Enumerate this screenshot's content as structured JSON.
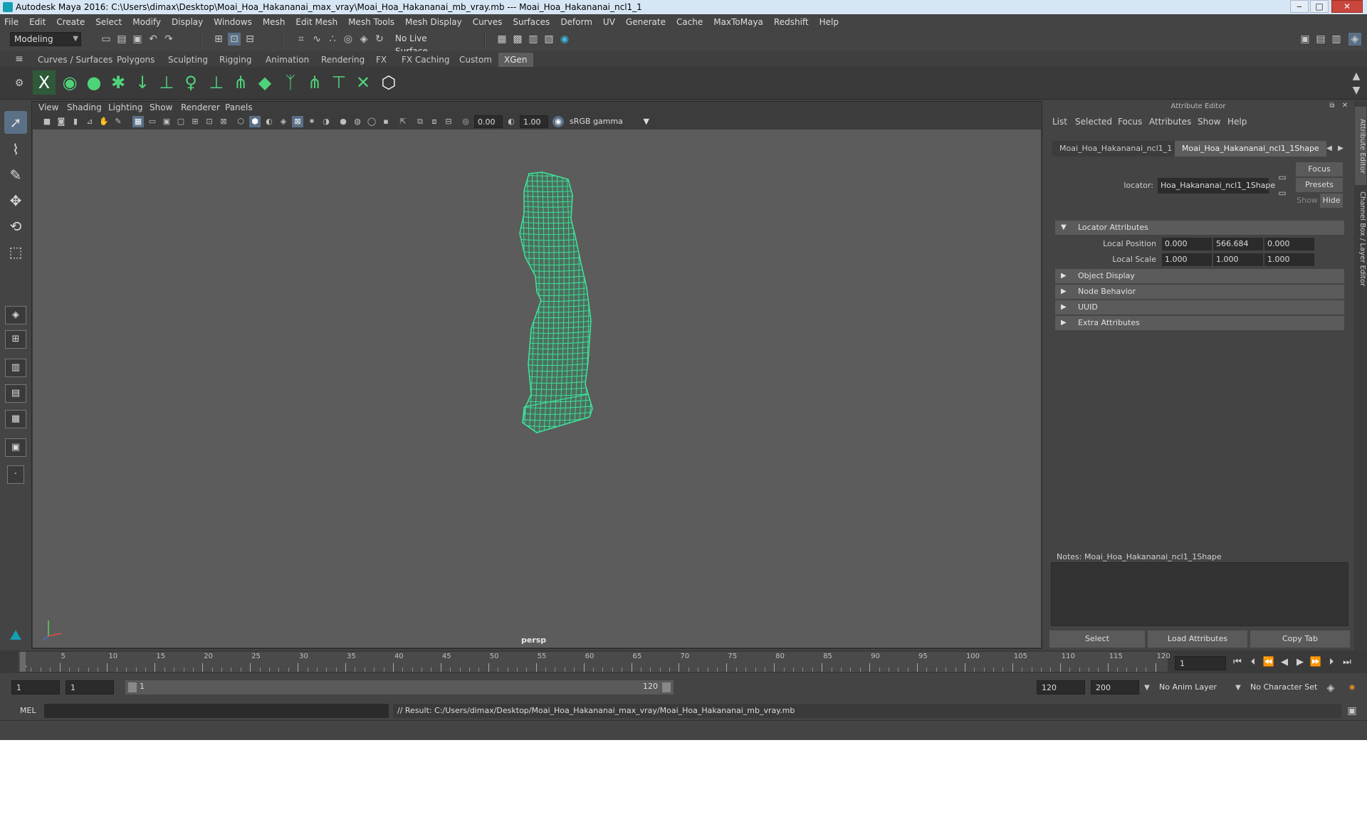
{
  "window": {
    "title": "Autodesk Maya 2016: C:\\Users\\dimax\\Desktop\\Moai_Hoa_Hakananai_max_vray\\Moai_Hoa_Hakananai_mb_vray.mb   ---   Moai_Hoa_Hakananai_ncl1_1",
    "minimize": "‒",
    "maximize": "□",
    "close": "✕"
  },
  "menubar": [
    "File",
    "Edit",
    "Create",
    "Select",
    "Modify",
    "Display",
    "Windows",
    "Mesh",
    "Edit Mesh",
    "Mesh Tools",
    "Mesh Display",
    "Curves",
    "Surfaces",
    "Deform",
    "UV",
    "Generate",
    "Cache",
    "MaxToMaya",
    "Redshift",
    "Help"
  ],
  "statusline": {
    "menuset": "Modeling",
    "live_surface": "No Live Surface"
  },
  "shelf": {
    "tabs": [
      "Curves / Surfaces",
      "Polygons",
      "Sculpting",
      "Rigging",
      "Animation",
      "Rendering",
      "FX",
      "FX Caching",
      "Custom",
      "XGen"
    ],
    "active_tab": "XGen"
  },
  "viewport": {
    "menus": [
      "View",
      "Shading",
      "Lighting",
      "Show",
      "Renderer",
      "Panels"
    ],
    "exposure": "0.00",
    "gamma": "1.00",
    "color_space": "sRGB gamma",
    "camera_label": "persp"
  },
  "attribute_editor": {
    "title": "Attribute Editor",
    "menus": [
      "List",
      "Selected",
      "Focus",
      "Attributes",
      "Show",
      "Help"
    ],
    "node_tabs": [
      "Moai_Hoa_Hakananai_ncl1_1",
      "Moai_Hoa_Hakananai_ncl1_1Shape"
    ],
    "active_tab": "Moai_Hoa_Hakananai_ncl1_1Shape",
    "node_label": "locator:",
    "node_name": "Hoa_Hakananai_ncl1_1Shape",
    "focus_btn": "Focus",
    "presets_btn": "Presets",
    "show_btn": "Show",
    "hide_btn": "Hide",
    "sections": {
      "locator": "Locator Attributes",
      "object_display": "Object Display",
      "node_behavior": "Node Behavior",
      "uuid": "UUID",
      "extra": "Extra Attributes"
    },
    "local_position": {
      "label": "Local Position",
      "x": "0.000",
      "y": "566.684",
      "z": "0.000"
    },
    "local_scale": {
      "label": "Local Scale",
      "x": "1.000",
      "y": "1.000",
      "z": "1.000"
    },
    "notes_label": "Notes:  Moai_Hoa_Hakananai_ncl1_1Shape",
    "buttons": {
      "select": "Select",
      "load": "Load Attributes",
      "copy": "Copy Tab"
    }
  },
  "side_tabs": [
    "Attribute Editor",
    "Channel Box / Layer Editor"
  ],
  "timeline": {
    "labels": [
      "1",
      "5",
      "10",
      "15",
      "20",
      "25",
      "30",
      "35",
      "40",
      "45",
      "50",
      "55",
      "60",
      "65",
      "70",
      "75",
      "80",
      "85",
      "90",
      "95",
      "100",
      "105",
      "110",
      "115",
      "120"
    ],
    "current_frame": "1"
  },
  "range": {
    "start": "1",
    "playback_start": "1",
    "slider_start": "1",
    "slider_end": "120",
    "playback_end": "120",
    "end": "200",
    "anim_layer": "No Anim Layer",
    "character_set": "No Character Set"
  },
  "command": {
    "lang": "MEL",
    "result": "// Result: C:/Users/dimax/Desktop/Moai_Hoa_Hakananai_max_vray/Moai_Hoa_Hakananai_mb_vray.mb"
  },
  "colors": {
    "wireframe": "#3ee69a",
    "accent": "#5a7087",
    "viewport_bg": "#5c5c5c"
  }
}
